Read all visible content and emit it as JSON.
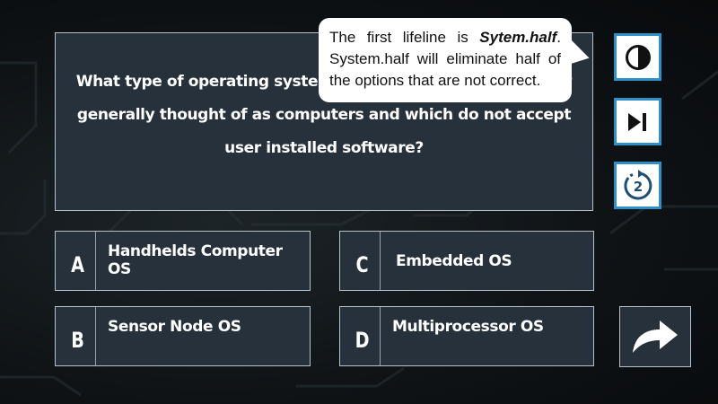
{
  "question": {
    "text": "What type of operating system runs on devices that are not generally thought of as computers and which do not accept user installed software?"
  },
  "answers": [
    {
      "letter": "A",
      "text": "Handhelds Computer OS"
    },
    {
      "letter": "B",
      "text": "Sensor Node OS"
    },
    {
      "letter": "C",
      "text": "Embedded OS"
    },
    {
      "letter": "D",
      "text": "Multiprocessor OS"
    }
  ],
  "lifelines": [
    {
      "id": "half",
      "icon": "half-contrast-icon"
    },
    {
      "id": "skip",
      "icon": "skip-next-icon"
    },
    {
      "id": "retry",
      "icon": "second-chance-icon",
      "badge": "2"
    }
  ],
  "next_button": {
    "icon": "forward-arrow-icon"
  },
  "tooltip": {
    "intro": "The first lifeline is ",
    "lifeline_name": "Sytem.half",
    "period": ".",
    "rest": "System.half will eliminate half of the options that are not correct."
  },
  "colors": {
    "panel": "#27313b",
    "border": "#b8c0c8",
    "lifeline_border": "#2e8fc9",
    "text": "#ffffff"
  }
}
